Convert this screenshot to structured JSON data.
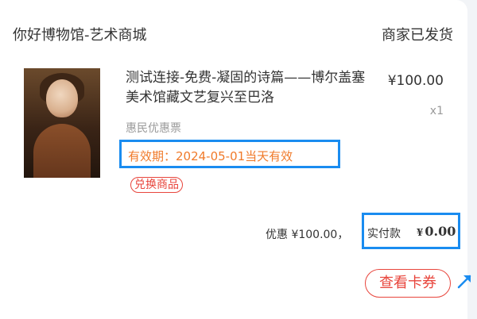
{
  "order": {
    "store_name": "你好博物馆-艺术商城",
    "status": "商家已发货"
  },
  "product": {
    "title": "测试连接-免费-凝固的诗篇——博尔盖塞美术馆藏文艺复兴至巴洛",
    "price": "¥100.00",
    "quantity": "x1",
    "coupon_type": "惠民优惠票",
    "validity": "有效期：2024-05-01当天有效",
    "tag": "兑换商品",
    "image_icon": "painting-portrait-cover"
  },
  "summary": {
    "discount_text": "优惠 ¥100.00，",
    "paid_label": "实付款",
    "paid_currency": "¥",
    "paid_amount": "0.00"
  },
  "actions": {
    "view_coupon": "查看卡券"
  },
  "colors": {
    "highlight_border": "#1a8cf0",
    "accent_red": "#e8453c",
    "validity_orange": "#f07a2a"
  }
}
